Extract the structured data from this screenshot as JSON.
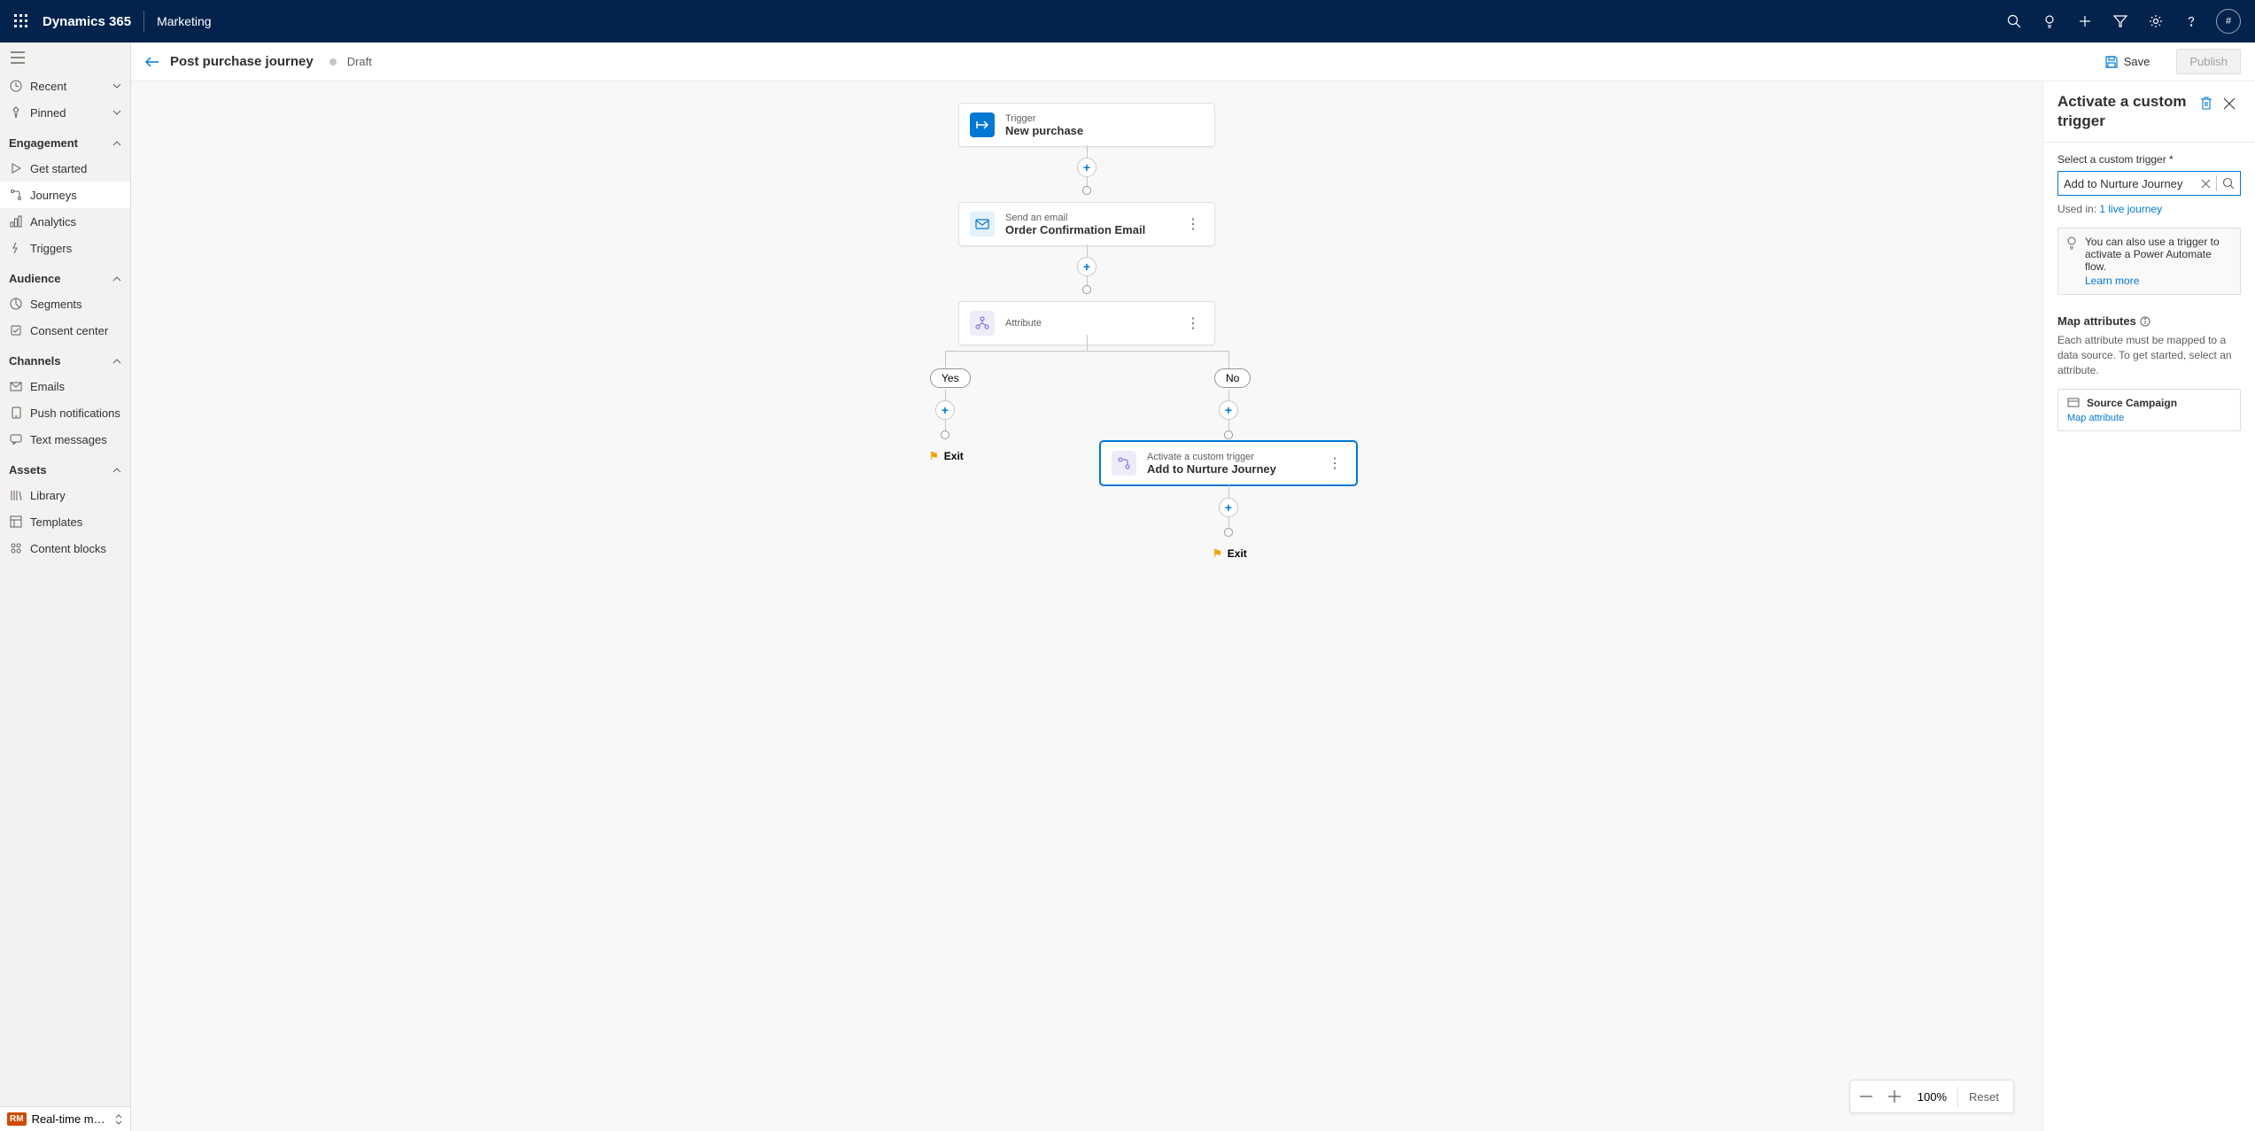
{
  "topbar": {
    "brand": "Dynamics 365",
    "module": "Marketing",
    "avatar": "#"
  },
  "nav": {
    "recent": "Recent",
    "pinned": "Pinned",
    "sections": {
      "engagement": {
        "label": "Engagement",
        "items": [
          {
            "icon": "play",
            "label": "Get started"
          },
          {
            "icon": "journey",
            "label": "Journeys",
            "active": true
          },
          {
            "icon": "analytics",
            "label": "Analytics"
          },
          {
            "icon": "trigger",
            "label": "Triggers"
          }
        ]
      },
      "audience": {
        "label": "Audience",
        "items": [
          {
            "icon": "segments",
            "label": "Segments"
          },
          {
            "icon": "consent",
            "label": "Consent center"
          }
        ]
      },
      "channels": {
        "label": "Channels",
        "items": [
          {
            "icon": "mail",
            "label": "Emails"
          },
          {
            "icon": "push",
            "label": "Push notifications"
          },
          {
            "icon": "text",
            "label": "Text messages"
          }
        ]
      },
      "assets": {
        "label": "Assets",
        "items": [
          {
            "icon": "library",
            "label": "Library"
          },
          {
            "icon": "templates",
            "label": "Templates"
          },
          {
            "icon": "blocks",
            "label": "Content blocks"
          }
        ]
      }
    },
    "footer": {
      "badge": "RM",
      "label": "Real-time marketi..."
    }
  },
  "page": {
    "title": "Post purchase journey",
    "status": "Draft",
    "save": "Save",
    "publish": "Publish"
  },
  "flow": {
    "trigger": {
      "type": "Trigger",
      "name": "New purchase"
    },
    "email": {
      "type": "Send an email",
      "name": "Order Confirmation Email"
    },
    "attribute": {
      "type": "Attribute",
      "name": ""
    },
    "yes": "Yes",
    "no": "No",
    "exit": "Exit",
    "custom": {
      "type": "Activate a custom trigger",
      "name": "Add to Nurture Journey"
    }
  },
  "zoom": {
    "value": "100%",
    "reset": "Reset"
  },
  "panel": {
    "title": "Activate a custom trigger",
    "selectLabel": "Select a custom trigger *",
    "selectedValue": "Add to Nurture Journey",
    "usedIn": "Used in:",
    "usedInLink": "1 live journey",
    "infoText": "You can also use a trigger to activate a Power Automate flow.",
    "learnMore": "Learn more",
    "mapHeader": "Map attributes",
    "mapDesc": "Each attribute must be mapped to a data source. To get started, select an attribute.",
    "attr1": "Source Campaign",
    "mapLink": "Map attribute"
  }
}
